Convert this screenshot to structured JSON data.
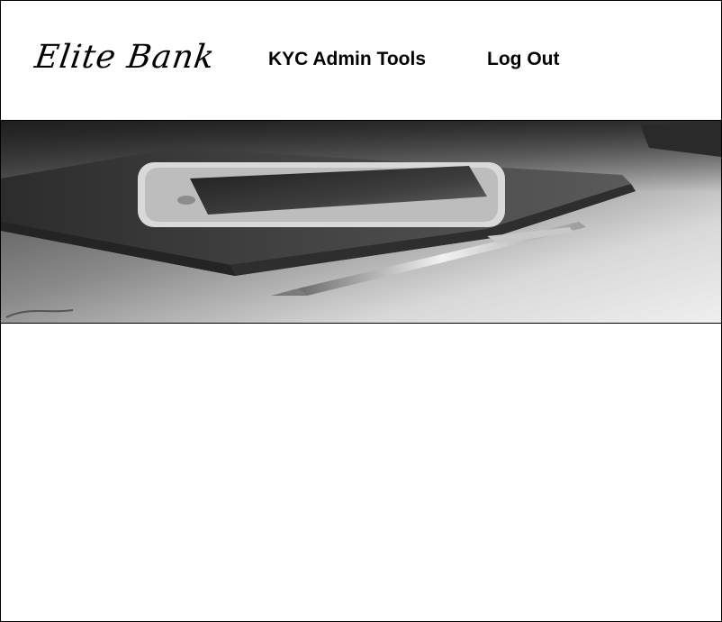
{
  "brand": {
    "name": "Elite Bank"
  },
  "nav": {
    "items": [
      {
        "label": "KYC Admin Tools"
      },
      {
        "label": "Log Out"
      }
    ]
  },
  "hero": {
    "image": "phone-notebook-pen-photo"
  },
  "colors": {
    "text": "#000000",
    "background": "#ffffff"
  }
}
